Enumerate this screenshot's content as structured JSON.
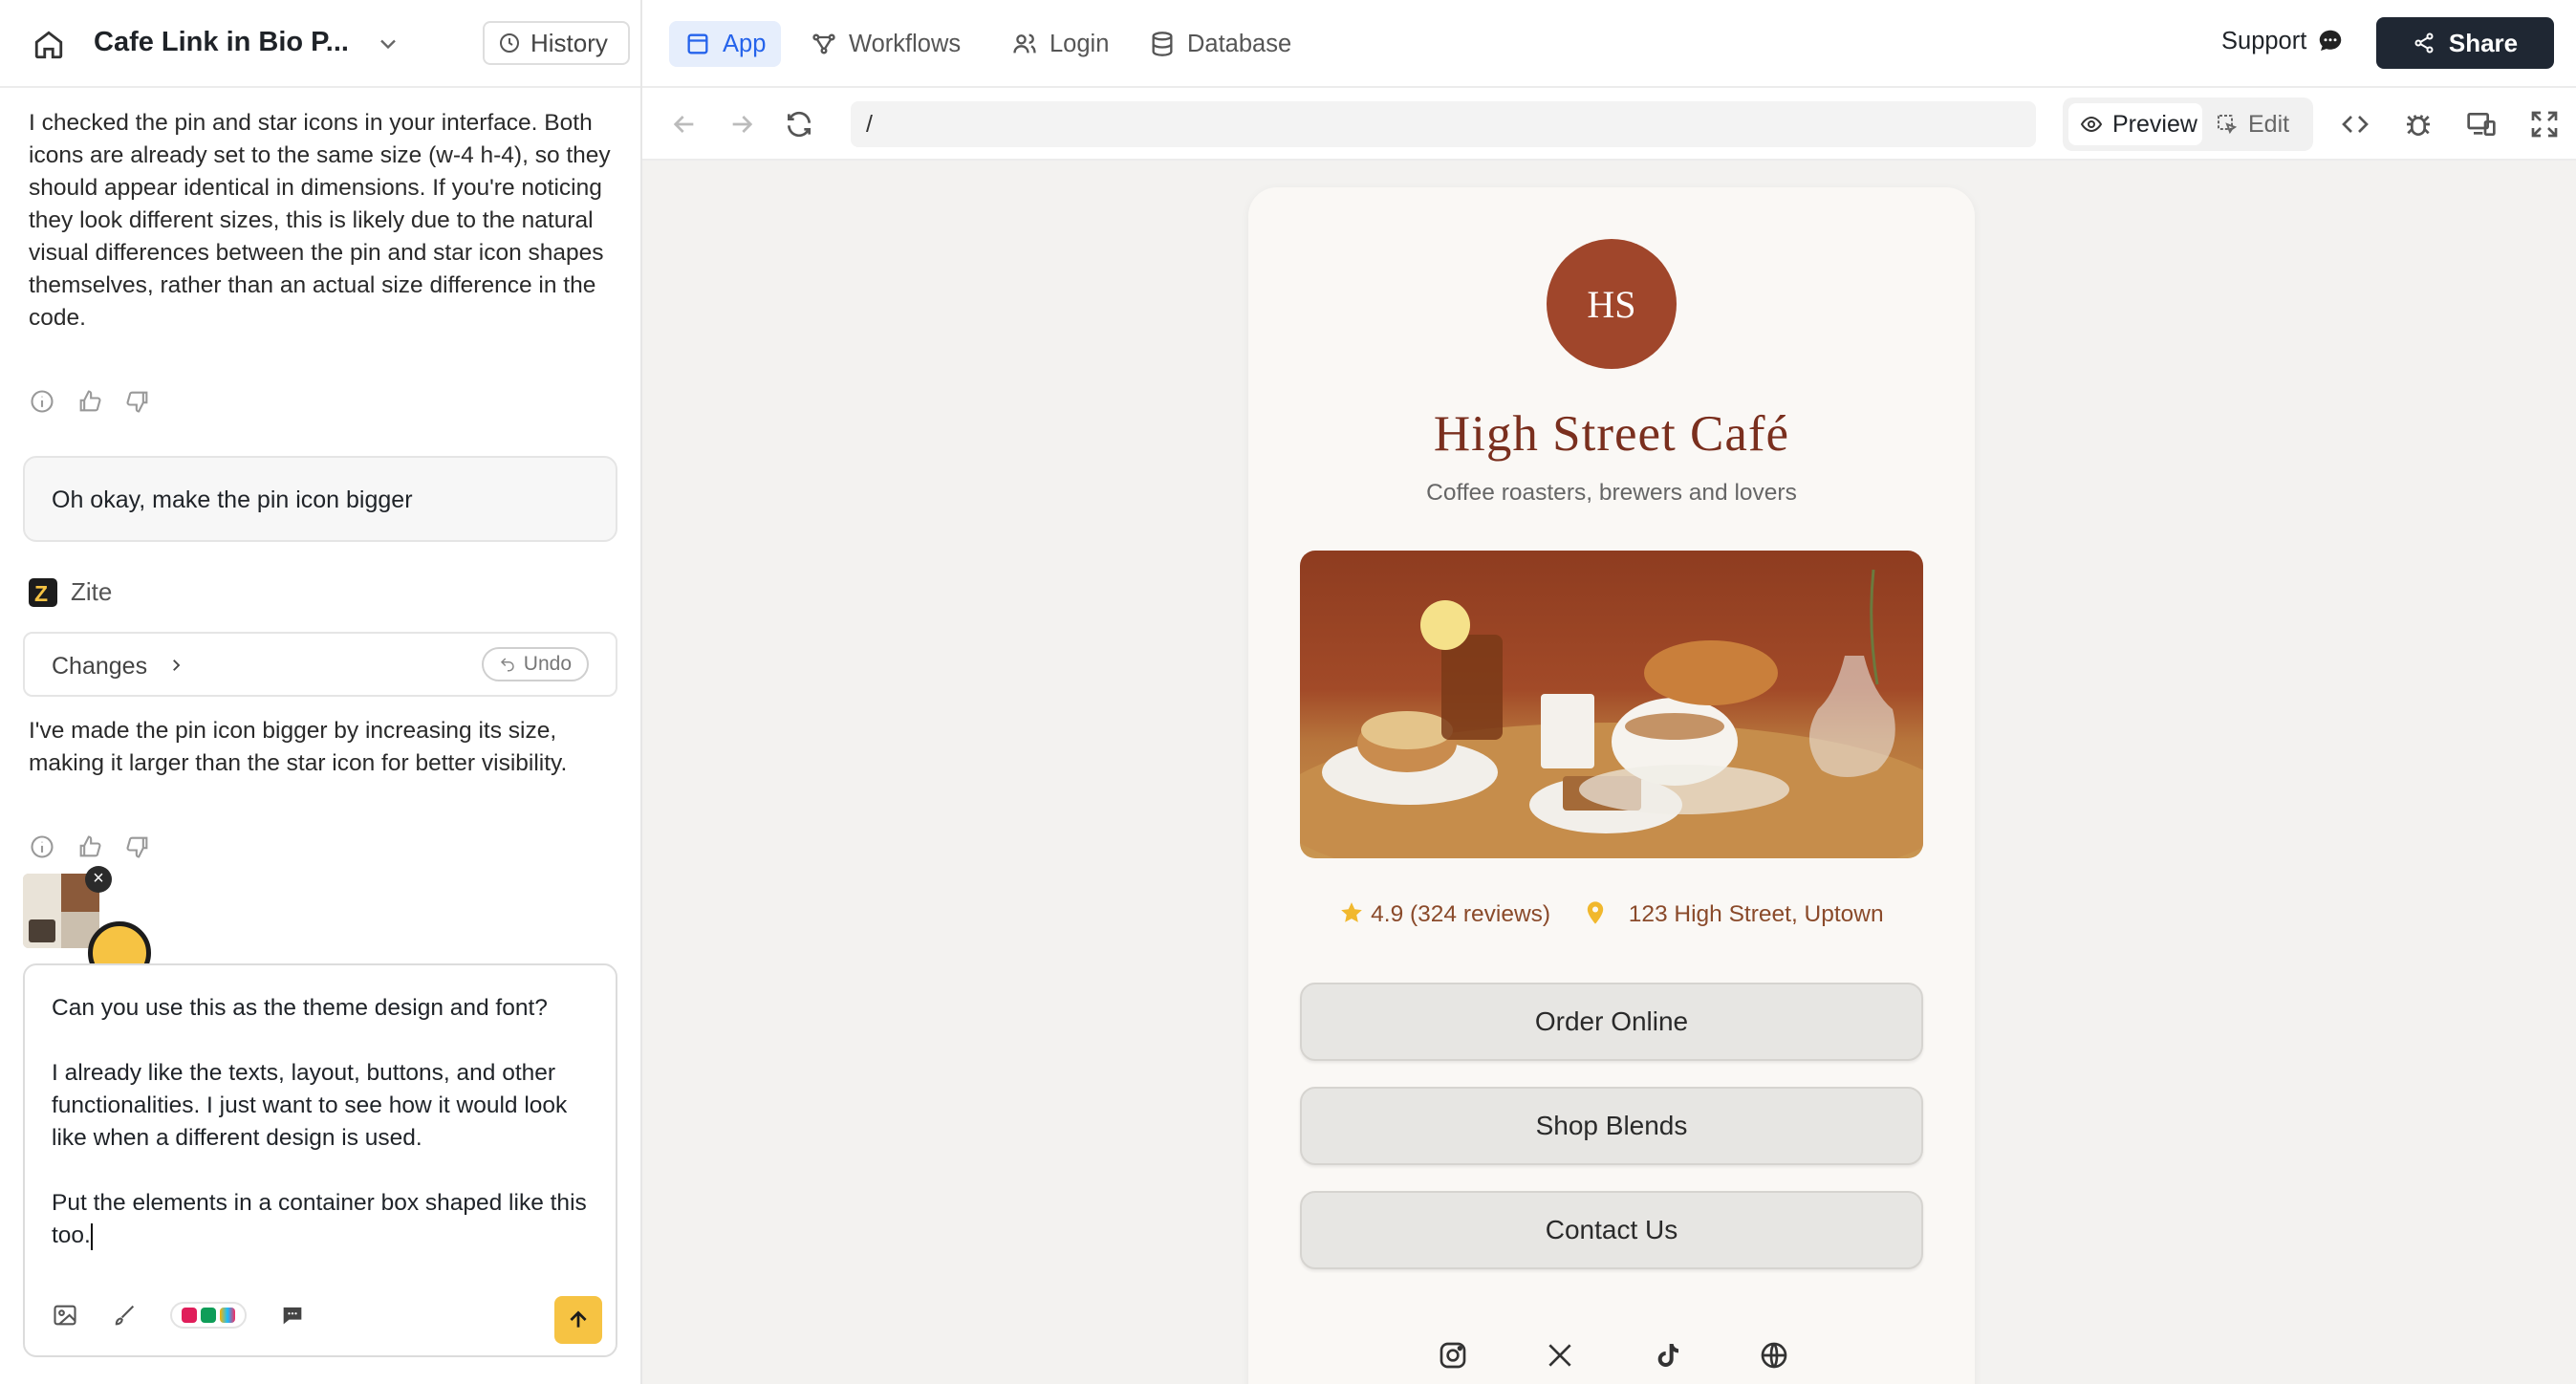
{
  "project": {
    "title": "Cafe Link in Bio P...",
    "history_label": "History"
  },
  "chat": {
    "messages": [
      {
        "role": "assistant",
        "text": "I checked the pin and star icons in your interface. Both icons are already set to the same size (w-4 h-4), so they should appear identical in dimensions. If you're noticing they look different sizes, this is likely due to the natural visual differences between the pin and star icon shapes themselves, rather than an actual size difference in the code."
      },
      {
        "role": "user",
        "text": "Oh okay, make the pin icon bigger"
      },
      {
        "role": "assistant",
        "text": "I've made the pin icon bigger by increasing its size, making it larger than the star icon for better visibility."
      }
    ],
    "assistant_name": "Zite",
    "changes_label": "Changes",
    "undo_label": "Undo",
    "composer": {
      "paragraphs": [
        "Can you use this as the theme design and font?",
        "I already like the texts, layout, buttons, and other functionalities. I just want to see how it would look like when a different design is used.",
        "Put the elements in a container box shaped like this too."
      ]
    }
  },
  "nav": {
    "tabs": [
      {
        "label": "App",
        "icon": "layout-icon",
        "active": true
      },
      {
        "label": "Workflows",
        "icon": "workflow-icon"
      },
      {
        "label": "Login",
        "icon": "users-icon"
      },
      {
        "label": "Database",
        "icon": "database-icon"
      }
    ],
    "support_label": "Support",
    "share_label": "Share"
  },
  "toolbar": {
    "url": "/",
    "preview_label": "Preview",
    "edit_label": "Edit"
  },
  "site": {
    "avatar_initials": "HS",
    "name": "High Street Café",
    "tagline": "Coffee roasters, brewers and lovers",
    "rating": "4.9 (324 reviews)",
    "address": "123 High Street, Uptown",
    "buttons": [
      "Order Online",
      "Shop Blends",
      "Contact Us"
    ],
    "social_icons": [
      "instagram-icon",
      "x-icon",
      "tiktok-icon",
      "globe-icon"
    ],
    "colors": {
      "accent": "#a0462b",
      "title": "#7a2f1e",
      "star": "#f1b82d"
    }
  },
  "brand_colors": {
    "send": "#f6c343",
    "share": "#1f2733",
    "active_tab": "#2563eb"
  }
}
